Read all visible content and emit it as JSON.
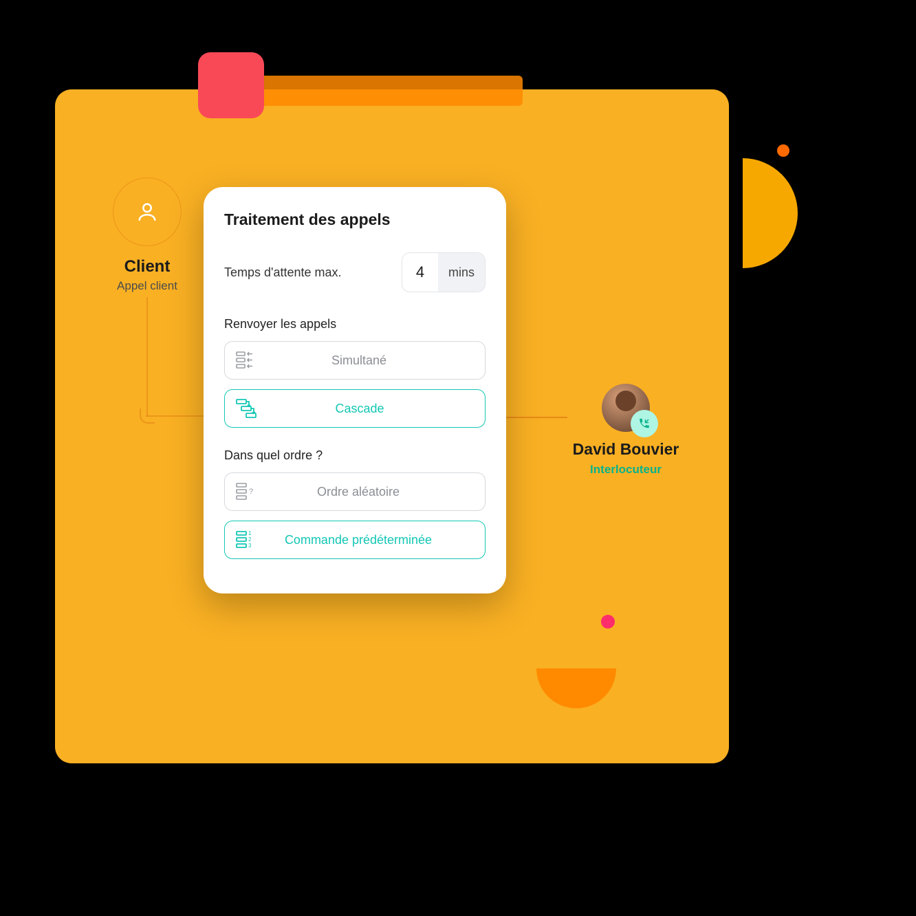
{
  "client": {
    "title": "Client",
    "subtitle": "Appel client"
  },
  "contact": {
    "name": "David Bouvier",
    "role": "Interlocuteur"
  },
  "card": {
    "title": "Traitement des appels",
    "wait_label": "Temps d'attente max.",
    "wait_value": "4",
    "wait_unit": "mins",
    "forward_label": "Renvoyer les appels",
    "forward_options": {
      "simultaneous": "Simultané",
      "cascade": "Cascade"
    },
    "order_label": "Dans quel ordre ?",
    "order_options": {
      "random": "Ordre aléatoire",
      "predetermined": "Commande prédéterminée"
    }
  }
}
